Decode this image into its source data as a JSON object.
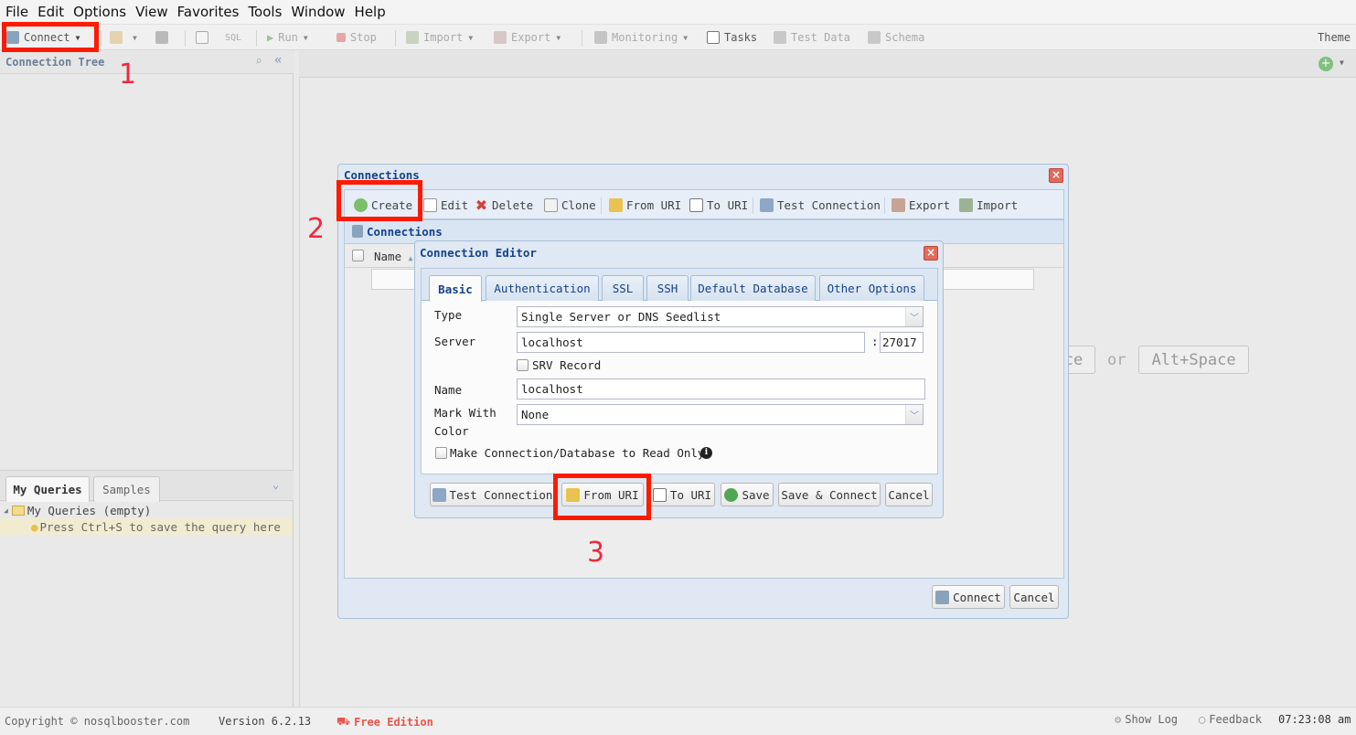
{
  "menubar": {
    "items": [
      "File",
      "Edit",
      "Options",
      "View",
      "Favorites",
      "Tools",
      "Window",
      "Help"
    ]
  },
  "toolbar": {
    "connect": "Connect",
    "sql": "SQL",
    "run": "Run",
    "stop": "Stop",
    "import": "Import",
    "export": "Export",
    "monitoring": "Monitoring",
    "tasks": "Tasks",
    "test_data": "Test Data",
    "schema": "Schema",
    "theme": "Theme"
  },
  "left": {
    "connection_tree": "Connection Tree",
    "tabs": [
      "My Queries",
      "Samples"
    ],
    "tree_root": "My Queries (empty)",
    "tree_hint": "Press Ctrl+S to save the query here"
  },
  "main": {
    "kbd_partial": "ce",
    "or": "or",
    "kbd_alt": "Alt+Space"
  },
  "connections_window": {
    "title": "Connections",
    "toolbar": [
      "Create",
      "Edit",
      "Delete",
      "Clone",
      "From URI",
      "To URI",
      "Test Connection",
      "Export",
      "Import"
    ],
    "grid_header": "Connections",
    "col_name": "Name",
    "connect": "Connect",
    "cancel": "Cancel"
  },
  "editor": {
    "title": "Connection Editor",
    "tabs": [
      "Basic",
      "Authentication",
      "SSL",
      "SSH",
      "Default Database",
      "Other Options"
    ],
    "type_label": "Type",
    "type_value": "Single Server or DNS Seedlist",
    "server_label": "Server",
    "server_value": "localhost",
    "port_sep": ":",
    "port_value": "27017",
    "srv_label": "SRV Record",
    "name_label": "Name",
    "name_value": "localhost",
    "mark_label_1": "Mark With",
    "mark_label_2": "Color",
    "mark_value": "None",
    "readonly_label": "Make Connection/Database to Read Only",
    "buttons": [
      "Test Connection",
      "From URI",
      "To URI",
      "Save",
      "Save & Connect",
      "Cancel"
    ]
  },
  "annotations": [
    "1",
    "2",
    "3"
  ],
  "status": {
    "copyright": "Copyright ©  nosqlbooster.com",
    "version": "Version 6.2.13",
    "edition": "Free Edition",
    "show_log": "Show Log",
    "feedback": "Feedback",
    "time": "07:23:08 am"
  },
  "colors": {
    "accent": "#15428b",
    "highlight": "#ff1a00",
    "edition": "#e8554a"
  }
}
